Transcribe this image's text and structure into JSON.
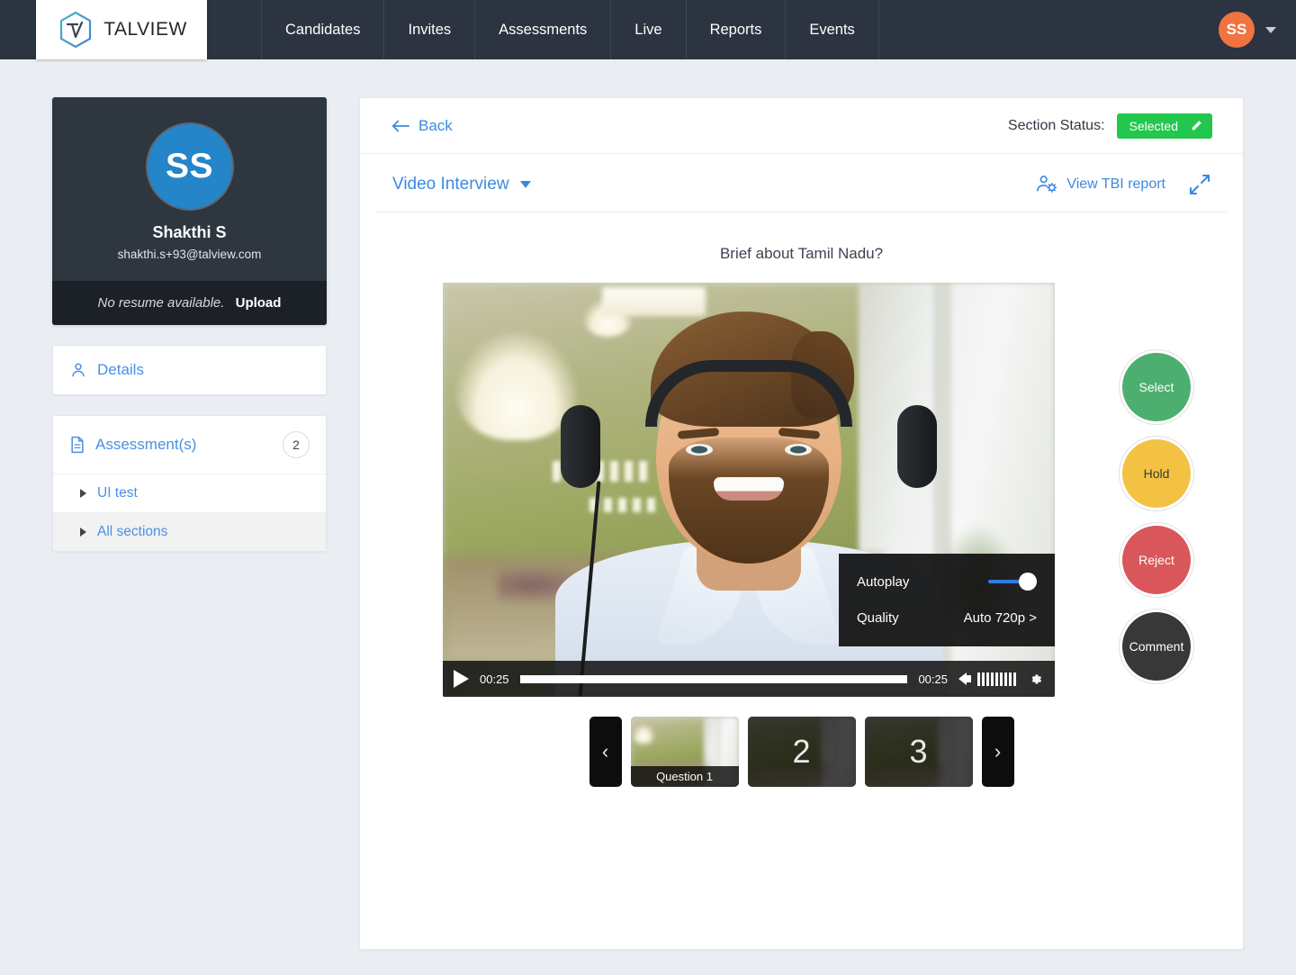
{
  "brand": {
    "name": "TALVIEW",
    "logo_icon": "talview-hexagon-logo"
  },
  "topnav": {
    "items": [
      {
        "label": "Candidates"
      },
      {
        "label": "Invites"
      },
      {
        "label": "Assessments"
      },
      {
        "label": "Live"
      },
      {
        "label": "Reports"
      },
      {
        "label": "Events"
      }
    ],
    "user_initials": "SS",
    "caret_icon": "chevron-down-icon"
  },
  "sidebar": {
    "profile": {
      "initials": "SS",
      "name": "Shakthi S",
      "email": "shakthi.s+93@talview.com",
      "resume_status": "No resume available.",
      "upload_label": "Upload"
    },
    "details": {
      "label": "Details",
      "icon": "person-icon"
    },
    "assessments": {
      "label": "Assessment(s)",
      "icon": "document-icon",
      "count": "2",
      "items": [
        {
          "label": "UI test",
          "selected": false
        },
        {
          "label": "All sections",
          "selected": true
        }
      ]
    }
  },
  "main": {
    "back_label": "Back",
    "back_icon": "arrow-left-icon",
    "status_label": "Section Status:",
    "status_value": "Selected",
    "status_edit_icon": "pencil-icon",
    "status_color": "#23c74d",
    "section_title": "Video Interview",
    "section_caret_icon": "caret-down-icon",
    "tbi_report_label": "View TBI report",
    "tbi_report_icon": "person-gear-icon",
    "expand_icon": "expand-arrows-icon",
    "question": "Brief about Tamil Nadu?"
  },
  "video": {
    "play_icon": "play-icon",
    "elapsed_time": "00:25",
    "total_time": "00:25",
    "speaker_icon": "speaker-icon",
    "settings_icon": "gear-icon",
    "progress_percent": 100,
    "settings_popup": {
      "autoplay_label": "Autoplay",
      "autoplay_on": true,
      "quality_label": "Quality",
      "quality_value": "Auto 720p >"
    }
  },
  "thumbnails": {
    "prev_icon": "chevron-left-icon",
    "next_icon": "chevron-right-icon",
    "prev_label": "‹",
    "next_label": "›",
    "items": [
      {
        "caption": "Question 1",
        "number": "",
        "active": true
      },
      {
        "caption": "",
        "number": "2",
        "active": false
      },
      {
        "caption": "",
        "number": "3",
        "active": false
      }
    ]
  },
  "actions": [
    {
      "label": "Select",
      "color": "#4caf6f"
    },
    {
      "label": "Hold",
      "color": "#f3c243"
    },
    {
      "label": "Reject",
      "color": "#d9575a"
    },
    {
      "label": "Comment",
      "color": "#383838"
    }
  ]
}
